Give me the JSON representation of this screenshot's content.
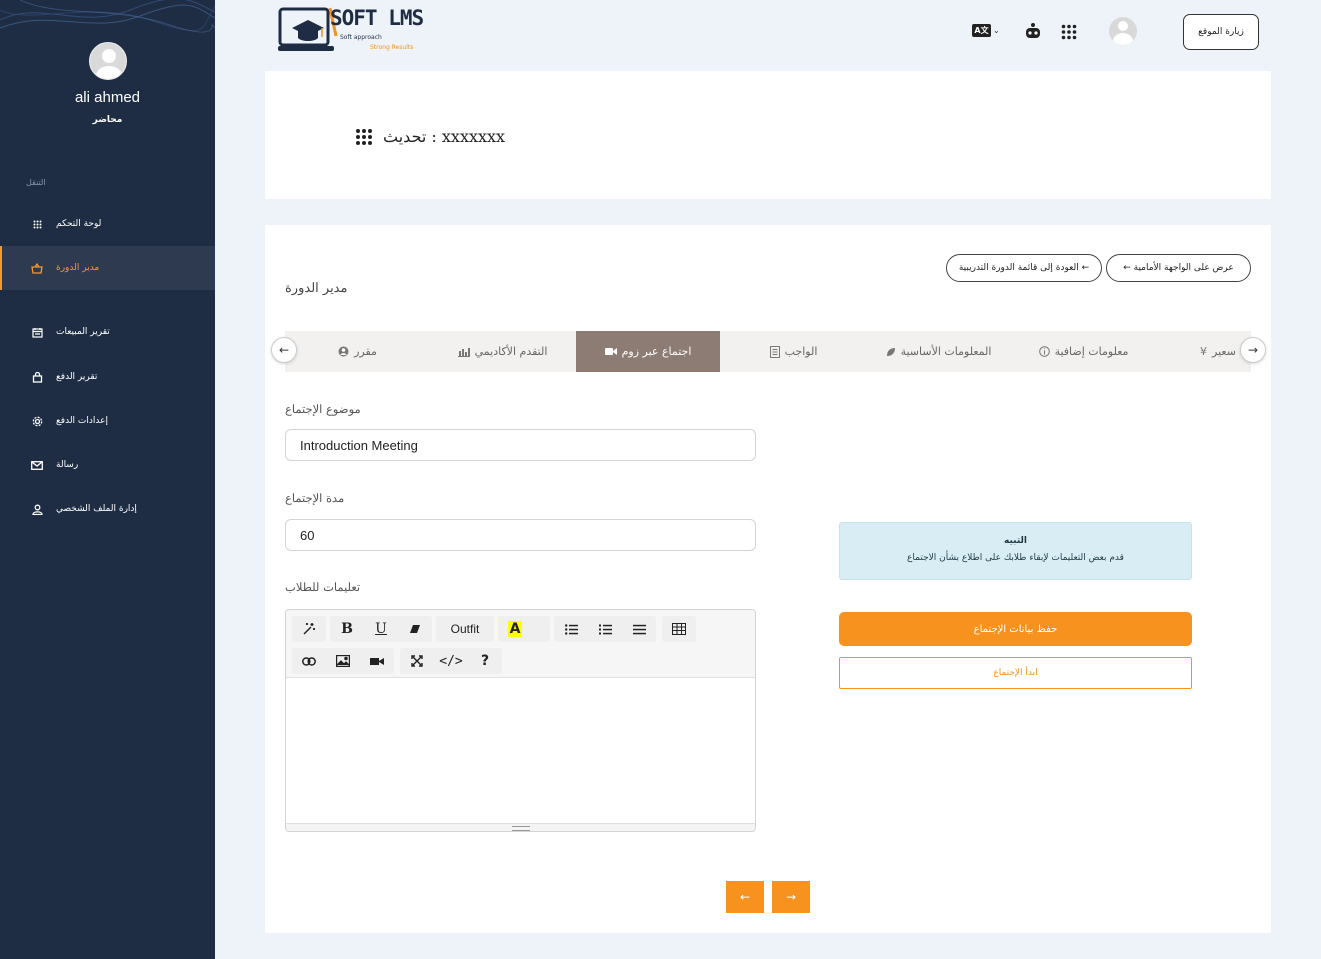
{
  "sidebar": {
    "user_name": "ali ahmed",
    "user_role": "محاضر",
    "nav_heading": "التنقل",
    "items": [
      {
        "label": "لوحة التحكم",
        "icon": "grid-icon"
      },
      {
        "label": "مدير الدورة",
        "icon": "basket-icon",
        "active": true
      },
      {
        "label": "تقرير المبيعات",
        "icon": "calendar-icon"
      },
      {
        "label": "تقرير الدفع",
        "icon": "bag-icon"
      },
      {
        "label": "إعدادات الدفع",
        "icon": "gear-icon"
      },
      {
        "label": "رسالة",
        "icon": "mail-icon"
      },
      {
        "label": "إدارة الملف الشخصي",
        "icon": "user-icon"
      }
    ]
  },
  "header": {
    "logo_text": "SOFT LMS",
    "logo_tagline_1": "Soft approach",
    "logo_tagline_2": "Strong Results",
    "visit_site_label": "زيارة الموقع",
    "lang_label": "A文"
  },
  "title_card": {
    "title": "تحديث : xxxxxxx"
  },
  "main": {
    "back_to_list": "العودة إلى قائمة الدورة التدريبية ←",
    "view_frontend": "← عرض على الواجهة الأمامية",
    "section_label": "مدير الدورة",
    "tabs": [
      {
        "label": "سعير",
        "icon": "yen-icon"
      },
      {
        "label": "معلومات إضافية",
        "icon": "info-icon"
      },
      {
        "label": "المعلومات الأساسية",
        "icon": "leaf-icon"
      },
      {
        "label": "الواجب",
        "icon": "doc-icon"
      },
      {
        "label": "اجتماع عبر زوم",
        "icon": "video-icon",
        "active": true
      },
      {
        "label": "التقدم الأكاديمي",
        "icon": "chart-icon"
      },
      {
        "label": "مقرر",
        "icon": "person-icon"
      }
    ],
    "meeting_topic_label": "موضوع الإجتماع",
    "meeting_topic_value": "Introduction Meeting",
    "meeting_duration_label": "مدة الإجتماع",
    "meeting_duration_value": "60",
    "instructions_label": "تعليمات للطلاب",
    "editor_font": "Outfit",
    "alert_title": "التبيه",
    "alert_body": "قدم بعض التعليمات لإبقاء طلابك على اطلاع بشأن الاجتماع",
    "save_button": "حفظ بيانات الإجتماع",
    "start_button": "ابدأ الإجتماع",
    "prev_arrow": "←",
    "next_arrow": "→"
  },
  "colors": {
    "sidebar_bg": "#1f2d44",
    "accent": "#f7921e",
    "active_tab": "#8d7c73",
    "alert_bg": "#d9eef4"
  }
}
